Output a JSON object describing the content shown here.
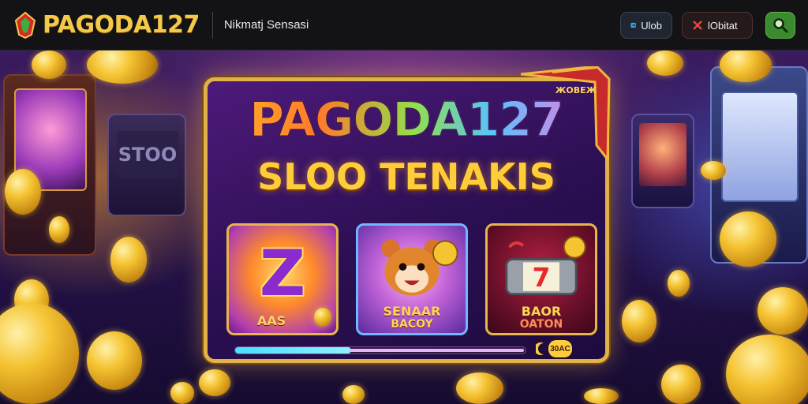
{
  "header": {
    "brand": "PAGODA127",
    "tagline": "Nikmatj Sensasi",
    "login_label": "Ulob",
    "daftar_label": "lObitat",
    "search_icon": "search-icon",
    "brand_colors": {
      "gold": "#f3c94a",
      "bar": "#131316",
      "search": "#3b8a2f"
    }
  },
  "hero": {
    "panel": {
      "title": "PAGODA127",
      "subtitle": "SLOO TENAKIS",
      "badge": "ЖОВЕЖ",
      "progress": 0.4,
      "pill_label": "30AC"
    },
    "cards": [
      {
        "glyph": "Z",
        "label": "AAS",
        "icon": "z-symbol-icon"
      },
      {
        "label_line1": "SENAAR",
        "label_line2": "BACOY",
        "icon": "fox-mascot-icon"
      },
      {
        "label_line1": "BAOR",
        "label_line2": "OATON",
        "icon": "slot-reel-icon"
      }
    ],
    "background_machine_text": "STOO"
  }
}
